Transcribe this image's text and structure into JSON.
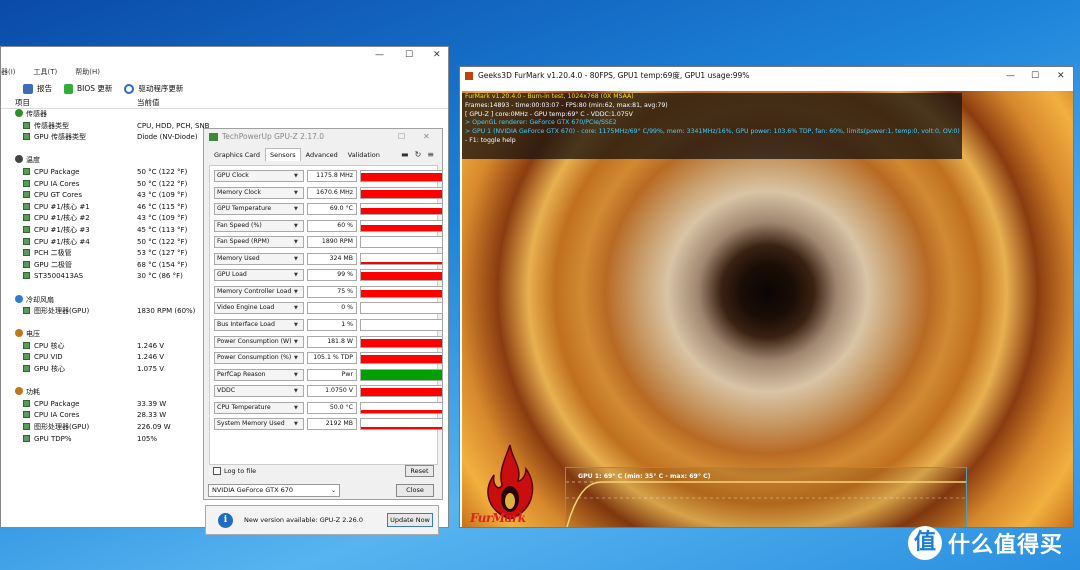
{
  "hwinfo": {
    "menu": [
      "(I)",
      "工具(T)",
      "帮助(H)"
    ],
    "menu_display": [
      "器(I)",
      "工具(T)",
      "帮助(H)"
    ],
    "toolbar": {
      "report": "报告",
      "bios": "BIOS 更新",
      "driver": "驱动程序更新"
    },
    "columns": {
      "item": "项目",
      "value": "当前值"
    },
    "rows": [
      {
        "name": "传感器",
        "value": "",
        "level": 0,
        "icon": "sensor-icon"
      },
      {
        "name": "传感器类型",
        "value": "CPU, HDD, PCH, SNB",
        "level": 1
      },
      {
        "name": "GPU 传感器类型",
        "value": "Diode  (NV-Diode)",
        "level": 1
      },
      {
        "name": "",
        "value": "",
        "level": -1
      },
      {
        "name": "温度",
        "value": "",
        "level": 0,
        "icon": "temperature-icon"
      },
      {
        "name": "CPU Package",
        "value": "50 °C  (122 °F)",
        "level": 1
      },
      {
        "name": "CPU IA Cores",
        "value": "50 °C  (122 °F)",
        "level": 1
      },
      {
        "name": "CPU GT Cores",
        "value": "43 °C  (109 °F)",
        "level": 1
      },
      {
        "name": "CPU #1/核心 #1",
        "value": "46 °C  (115 °F)",
        "level": 1
      },
      {
        "name": "CPU #1/核心 #2",
        "value": "43 °C  (109 °F)",
        "level": 1
      },
      {
        "name": "CPU #1/核心 #3",
        "value": "45 °C  (113 °F)",
        "level": 1
      },
      {
        "name": "CPU #1/核心 #4",
        "value": "50 °C  (122 °F)",
        "level": 1
      },
      {
        "name": "PCH 二极管",
        "value": "53 °C  (127 °F)",
        "level": 1
      },
      {
        "name": "GPU 二极管",
        "value": "68 °C  (154 °F)",
        "level": 1
      },
      {
        "name": "ST3500413AS",
        "value": "30 °C  (86 °F)",
        "level": 1
      },
      {
        "name": "",
        "value": "",
        "level": -1
      },
      {
        "name": "冷却风扇",
        "value": "",
        "level": 0,
        "icon": "fan-icon"
      },
      {
        "name": "图形处理器(GPU)",
        "value": "1830 RPM  (60%)",
        "level": 1
      },
      {
        "name": "",
        "value": "",
        "level": -1
      },
      {
        "name": "电压",
        "value": "",
        "level": 0,
        "icon": "voltage-icon"
      },
      {
        "name": "CPU 核心",
        "value": "1.246 V",
        "level": 1
      },
      {
        "name": "CPU VID",
        "value": "1.246 V",
        "level": 1
      },
      {
        "name": "GPU 核心",
        "value": "1.075 V",
        "level": 1
      },
      {
        "name": "",
        "value": "",
        "level": -1
      },
      {
        "name": "功耗",
        "value": "",
        "level": 0,
        "icon": "power-icon"
      },
      {
        "name": "CPU Package",
        "value": "33.39 W",
        "level": 1
      },
      {
        "name": "CPU IA Cores",
        "value": "28.33 W",
        "level": 1
      },
      {
        "name": "图形处理器(GPU)",
        "value": "226.09 W",
        "level": 1
      },
      {
        "name": "GPU TDP%",
        "value": "105%",
        "level": 1
      }
    ]
  },
  "gpuz": {
    "title": "TechPowerUp GPU-Z 2.17.0",
    "tabs": [
      "Graphics Card",
      "Sensors",
      "Advanced",
      "Validation"
    ],
    "active_tab": 1,
    "sensors": [
      {
        "label": "GPU Clock",
        "value": "1175.8 MHz",
        "graph": "red",
        "level": 0.8
      },
      {
        "label": "Memory Clock",
        "value": "1670.6 MHz",
        "graph": "red",
        "level": 0.8
      },
      {
        "label": "GPU Temperature",
        "value": "69.0 °C",
        "graph": "red",
        "level": 0.6
      },
      {
        "label": "Fan Speed (%)",
        "value": "60 %",
        "graph": "red",
        "level": 0.55
      },
      {
        "label": "Fan Speed (RPM)",
        "value": "1890 RPM",
        "graph": "none",
        "level": 0
      },
      {
        "label": "Memory Used",
        "value": "324 MB",
        "graph": "red",
        "level": 0.15
      },
      {
        "label": "GPU Load",
        "value": "99 %",
        "graph": "red",
        "level": 0.85
      },
      {
        "label": "Memory Controller Load",
        "value": "75 %",
        "graph": "red",
        "level": 0.7
      },
      {
        "label": "Video Engine Load",
        "value": "0 %",
        "graph": "none",
        "level": 0
      },
      {
        "label": "Bus Interface Load",
        "value": "1 %",
        "graph": "none",
        "level": 0
      },
      {
        "label": "Power Consumption (W)",
        "value": "181.8 W",
        "graph": "red",
        "level": 0.8
      },
      {
        "label": "Power Consumption (%)",
        "value": "105.1 % TDP",
        "graph": "red",
        "level": 0.8
      },
      {
        "label": "PerfCap Reason",
        "value": "Pwr",
        "graph": "green",
        "level": 1
      },
      {
        "label": "VDDC",
        "value": "1.0750 V",
        "graph": "red",
        "level": 0.85
      },
      {
        "label": "CPU Temperature",
        "value": "50.0 °C",
        "graph": "red",
        "level": 0.25
      },
      {
        "label": "System Memory Used",
        "value": "2192 MB",
        "graph": "red",
        "level": 0.25
      }
    ],
    "log_label": "Log to file",
    "reset": "Reset",
    "gpu": "NVIDIA GeForce GTX 670",
    "close": "Close",
    "update_msg": "New version available: GPU-Z 2.26.0",
    "update_btn": "Update Now",
    "colors": {
      "red": "#ff0000",
      "green": "#00a000"
    }
  },
  "furmark": {
    "title": "Geeks3D FurMark v1.20.4.0 - 80FPS, GPU1 temp:69度, GPU1 usage:99%",
    "overlay": [
      {
        "text": "FurMark v1.20.4.0 - Burn-in test, 1024x768 (0X MSAA)",
        "color": "#ffe000"
      },
      {
        "text": "Frames:14893 - time:00:03:07 - FPS:80 (min:62, max:81, avg:79)",
        "color": "#ffffff"
      },
      {
        "text": "[ GPU-Z ] core:0MHz - GPU temp:69° C - VDDC:1.075V",
        "color": "#ffffff"
      },
      {
        "text": "> OpenGL renderer: GeForce GTX 670/PCIe/SSE2",
        "color": "#40d0ff"
      },
      {
        "text": "> GPU 1 (NVIDIA GeForce GTX 670) - core: 1175MHz/69° C/99%, mem: 3341MHz/16%, GPU power: 103.6% TDP, fan: 60%, limits(power:1, temp:0, volt:0, OV:0)",
        "color": "#40d0ff"
      },
      {
        "text": "- F1: toggle help",
        "color": "#ffffff"
      }
    ],
    "graph_label": "GPU 1: 69° C (min: 35° C - max: 69° C)",
    "temp_series": {
      "min": 35,
      "max": 69,
      "current": 69
    },
    "logo_text": "FurMark"
  },
  "watermark": {
    "glyph": "值",
    "text": "什么值得买"
  }
}
